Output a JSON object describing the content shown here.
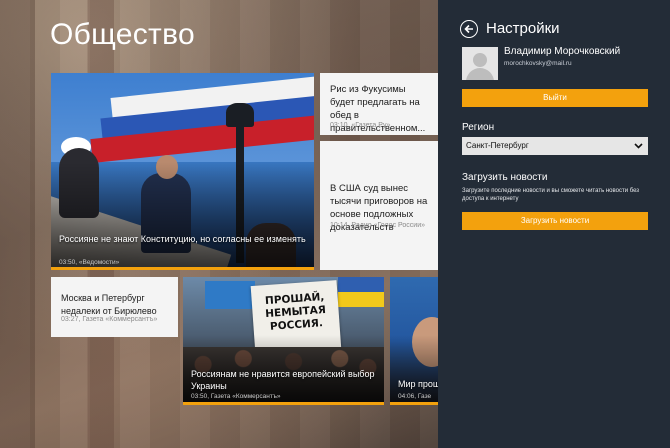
{
  "app": {
    "page_title": "Общество",
    "tiles": {
      "big": {
        "caption": "Россияне не знают Конституцию, но согласны ее изменять",
        "meta": "03:50, «Ведомости»"
      },
      "fukushima": {
        "headline": "Рис из Фукусимы будет предлагать на обед в правительственном...",
        "meta": "03:10, «Газета.Ру»"
      },
      "usa": {
        "headline": "В США суд вынес тысячи приговоров на основе подложных доказательств",
        "meta": "10:14, Радио «Голос России»"
      },
      "moscow": {
        "headline": "Москва и Петербург недалеки от Бирюлево",
        "meta": "03:27, Газета «Коммерсантъ»"
      },
      "protest": {
        "caption": "Россиянам не нравится европейский выбор Украины",
        "meta": "03:50, Газета «Коммерсантъ»",
        "poster": "ПРОШАЙ,\nНЕМЫТАЯ\nРОССИЯ."
      },
      "mir": {
        "caption": "Мир прошел",
        "meta": "04:06, Газе"
      }
    }
  },
  "settings": {
    "title": "Настройки",
    "user": {
      "name": "Владимир Морочковский",
      "email": "morochkovsky@mail.ru"
    },
    "login_button": "Выйти",
    "region": {
      "label": "Регион",
      "value": "Санкт-Петербург"
    },
    "load": {
      "label": "Загрузить новости",
      "description": "Загрузите последние новости и вы сможете читать новости без доступа к интернету",
      "button": "Загрузить новости"
    },
    "colors": {
      "accent": "#f3a10d",
      "flyout_bg": "#232c37"
    }
  }
}
